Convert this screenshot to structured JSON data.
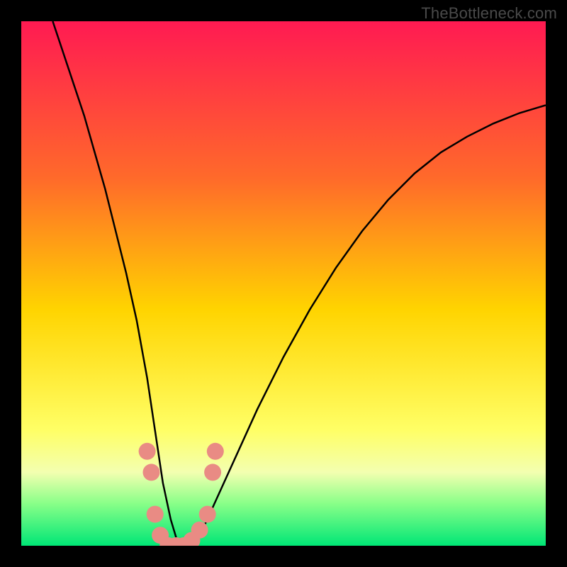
{
  "watermark": "TheBottleneck.com",
  "chart_data": {
    "type": "line",
    "title": "",
    "xlabel": "",
    "ylabel": "",
    "xlim": [
      0,
      100
    ],
    "ylim": [
      0,
      100
    ],
    "grid": false,
    "background_gradient": {
      "stops": [
        {
          "offset": 0,
          "color": "#ff1a52"
        },
        {
          "offset": 30,
          "color": "#ff6a2a"
        },
        {
          "offset": 55,
          "color": "#ffd400"
        },
        {
          "offset": 78,
          "color": "#ffff66"
        },
        {
          "offset": 86,
          "color": "#f3ffb0"
        },
        {
          "offset": 92,
          "color": "#88ff88"
        },
        {
          "offset": 100,
          "color": "#00e676"
        }
      ]
    },
    "series": [
      {
        "name": "bottleneck-curve",
        "color": "#000000",
        "x": [
          6,
          8,
          10,
          12,
          14,
          16,
          18,
          20,
          22,
          24,
          25.5,
          27,
          28.5,
          30,
          32,
          35,
          40,
          45,
          50,
          55,
          60,
          65,
          70,
          75,
          80,
          85,
          90,
          95,
          100
        ],
        "y": [
          100,
          94,
          88,
          82,
          75,
          68,
          60,
          52,
          43,
          32,
          22,
          12,
          5,
          0,
          0,
          4,
          15,
          26,
          36,
          45,
          53,
          60,
          66,
          71,
          75,
          78,
          80.5,
          82.5,
          84
        ]
      }
    ],
    "markers": {
      "name": "highlight-dots",
      "color": "#e98b84",
      "radius": 12,
      "points": [
        {
          "x": 24.0,
          "y": 18
        },
        {
          "x": 24.8,
          "y": 14
        },
        {
          "x": 25.5,
          "y": 6
        },
        {
          "x": 26.5,
          "y": 2
        },
        {
          "x": 28.0,
          "y": 0
        },
        {
          "x": 29.5,
          "y": 0
        },
        {
          "x": 31.0,
          "y": 0
        },
        {
          "x": 32.5,
          "y": 1
        },
        {
          "x": 34.0,
          "y": 3
        },
        {
          "x": 35.5,
          "y": 6
        },
        {
          "x": 36.5,
          "y": 14
        },
        {
          "x": 37.0,
          "y": 18
        }
      ]
    }
  }
}
